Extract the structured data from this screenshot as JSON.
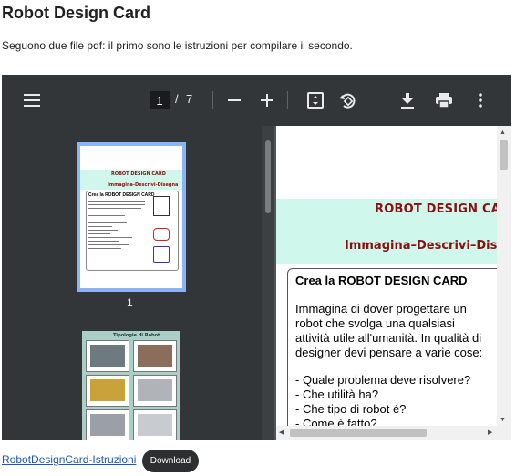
{
  "page": {
    "title": "Robot Design Card",
    "intro": "Seguono due file pdf: il primo sono le istruzioni per compilare il secondo."
  },
  "viewer": {
    "toolbar": {
      "current_page": "1",
      "separator": "/",
      "total_pages": "7"
    },
    "sidebar": {
      "thumb1_number": "1",
      "thumb1": {
        "title": "ROBOT DESIGN CARD",
        "subtitle": "Immagina-Descrivi-Disegna",
        "box_title": "Crea la ROBOT DESIGN CARD"
      },
      "thumb2": {
        "title": "Tipologie di Robot"
      }
    },
    "document": {
      "heading1": "ROBOT DESIGN CARD",
      "heading2": "Immagina–Descrivi–Disegna",
      "box_title": "Crea la ROBOT DESIGN CARD",
      "paragraph": "Immagina di dover progettare un robot che svolga una qualsiasi attività utile all'umanità. In qualità di designer devi pensare a varie cose:",
      "list": [
        "- Quale problema deve risolvere?",
        "- Che utilità ha?",
        "- Che tipo di robot é?",
        "- Come è fatto?"
      ]
    }
  },
  "footer": {
    "file_link": "RobotDesignCard-Istruzioni",
    "download_label": "Download"
  },
  "colors": {
    "toolbar_bg": "#323639",
    "viewer_bg": "#525659",
    "doc_band": "#cff7ec",
    "doc_heading": "#8b0f0f",
    "thumb_highlight": "#8ab4f8",
    "link": "#1a56c7"
  },
  "icons": [
    "menu-icon",
    "zoom-out-icon",
    "zoom-in-icon",
    "fit-page-icon",
    "rotate-icon",
    "download-icon",
    "print-icon",
    "more-vert-icon"
  ]
}
